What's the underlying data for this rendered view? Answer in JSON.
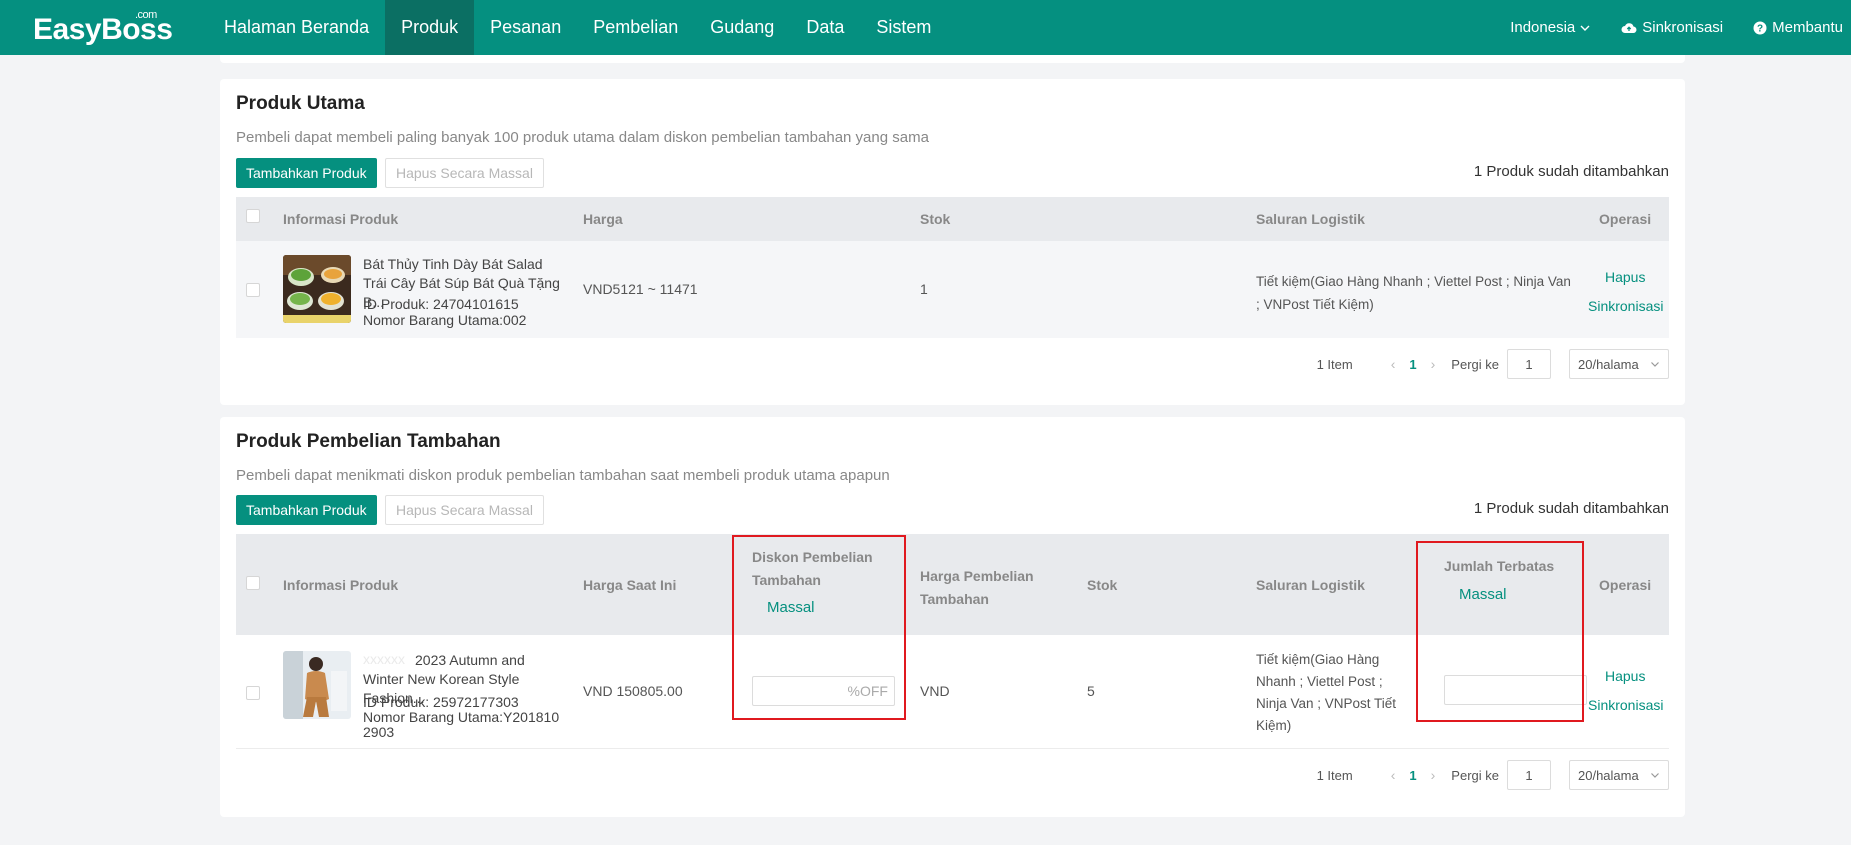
{
  "header": {
    "logo": "EasyBoss",
    "logo_sup": ".com",
    "nav": [
      "Halaman Beranda",
      "Produk",
      "Pesanan",
      "Pembelian",
      "Gudang",
      "Data",
      "Sistem"
    ],
    "active_nav": "Produk",
    "language": "Indonesia",
    "sync": "Sinkronisasi",
    "help": "Membantu"
  },
  "main_products": {
    "title": "Produk Utama",
    "description": "Pembeli dapat membeli paling banyak 100 produk utama dalam diskon pembelian tambahan yang sama",
    "add_button": "Tambahkan Produk",
    "bulk_delete_button": "Hapus Secara Massal",
    "count_text": "1 Produk sudah ditambahkan",
    "columns": [
      "Informasi Produk",
      "Harga",
      "Stok",
      "Saluran Logistik",
      "Operasi"
    ],
    "rows": [
      {
        "name": "Bát Thủy Tinh Dày Bát Salad Trái Cây Bát Súp Bát Quà Tặng B...",
        "product_id": "ID Produk: 24704101615",
        "sku": "Nomor Barang Utama:002",
        "price": "VND5121 ~ 11471",
        "stock": "1",
        "logistics": "Tiết kiệm(Giao Hàng Nhanh ; Viettel Post ; Ninja Van ; VNPost Tiết Kiệm)",
        "op_delete": "Hapus",
        "op_sync": "Sinkronisasi"
      }
    ],
    "pagination": {
      "total": "1 Item",
      "current_page": "1",
      "goto_label": "Pergi ke",
      "goto_value": "1",
      "page_size": "20/halama"
    }
  },
  "addon_products": {
    "title": "Produk Pembelian Tambahan",
    "description": "Pembeli dapat menikmati diskon produk pembelian tambahan saat membeli produk utama apapun",
    "add_button": "Tambahkan Produk",
    "bulk_delete_button": "Hapus Secara Massal",
    "count_text": "1 Produk sudah ditambahkan",
    "columns": {
      "info": "Informasi Produk",
      "current_price": "Harga Saat Ini",
      "discount": "Diskon Pembelian Tambahan",
      "discount_bulk": "Massal",
      "addon_price": "Harga Pembelian Tambahan",
      "stock": "Stok",
      "logistics": "Saluran Logistik",
      "limit": "Jumlah Terbatas",
      "limit_bulk": "Massal",
      "operation": "Operasi"
    },
    "rows": [
      {
        "name_faded": "xxxxxx",
        "name": "2023 Autumn and Winter New Korean Style Fashion...",
        "product_id": "ID Produk: 25972177303",
        "sku": "Nomor Barang Utama:Y2018102903",
        "current_price": "VND 150805.00",
        "discount_placeholder": "%OFF",
        "addon_price": "VND",
        "stock": "5",
        "logistics": "Tiết kiệm(Giao Hàng Nhanh ; Viettel Post ; Ninja Van ; VNPost Tiết Kiệm)",
        "op_delete": "Hapus",
        "op_sync": "Sinkronisasi"
      }
    ],
    "pagination": {
      "total": "1 Item",
      "current_page": "1",
      "goto_label": "Pergi ke",
      "goto_value": "1",
      "page_size": "20/halama"
    }
  },
  "colors": {
    "brand": "#059080",
    "nav_active": "#0b6f63",
    "highlight": "#e0191f"
  }
}
